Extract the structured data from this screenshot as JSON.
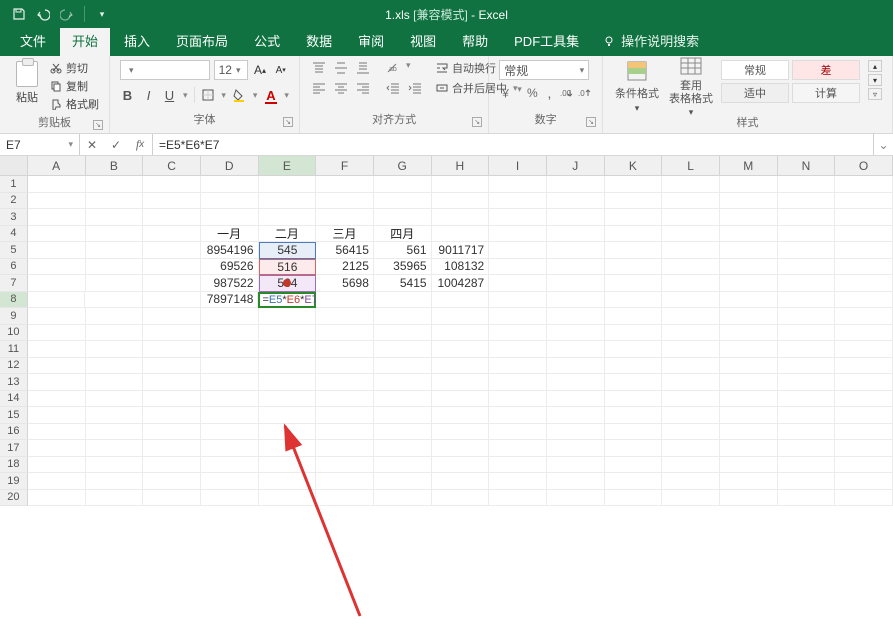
{
  "titlebar": {
    "filename": "1.xls",
    "compat": "[兼容模式]",
    "app": "Excel"
  },
  "tabs": {
    "file": "文件",
    "home": "开始",
    "insert": "插入",
    "layout": "页面布局",
    "formulas": "公式",
    "data": "数据",
    "review": "审阅",
    "view": "视图",
    "help": "帮助",
    "pdf": "PDF工具集",
    "tellme": "操作说明搜索"
  },
  "ribbon": {
    "clipboard": {
      "label": "剪贴板",
      "paste": "粘贴",
      "cut": "剪切",
      "copy": "复制",
      "brush": "格式刷"
    },
    "font": {
      "label": "字体",
      "size": "12"
    },
    "alignment": {
      "label": "对齐方式",
      "wrap": "自动换行",
      "merge": "合并后居中"
    },
    "number": {
      "label": "数字",
      "format": "常规"
    },
    "styles": {
      "label": "样式",
      "condfmt": "条件格式",
      "tablefmt": "套用\n表格格式",
      "normal": "常规",
      "bad": "差",
      "neutral": "适中",
      "calc": "计算"
    }
  },
  "fx": {
    "namebox": "E7",
    "formula": "=E5*E6*E7"
  },
  "grid": {
    "columns": [
      "A",
      "B",
      "C",
      "D",
      "E",
      "F",
      "G",
      "H",
      "I",
      "J",
      "K",
      "L",
      "M",
      "N",
      "O"
    ],
    "rows": 20,
    "headers_row": 4,
    "headers": {
      "D": "一月",
      "E": "二月",
      "F": "三月",
      "G": "四月"
    },
    "data": {
      "5": {
        "D": "8954196",
        "E": "545",
        "F": "56415",
        "G": "561",
        "H": "9011717"
      },
      "6": {
        "D": "69526",
        "E": "516",
        "F": "2125",
        "G": "35965",
        "H": "108132"
      },
      "7": {
        "D": "987522",
        "E": "564",
        "F": "5698",
        "G": "5415",
        "H": "1004287"
      },
      "8": {
        "D": "7897148"
      }
    },
    "editing_cell": {
      "row": 8,
      "col": "E",
      "tokens": [
        "=",
        "E5",
        "*",
        "E6",
        "*",
        "E7"
      ]
    },
    "selected_col": "E",
    "selected_row": 8
  },
  "chart_data": {
    "type": "table",
    "title": "",
    "columns": [
      "一月",
      "二月",
      "三月",
      "四月",
      ""
    ],
    "rows": [
      [
        8954196,
        545,
        56415,
        561,
        9011717
      ],
      [
        69526,
        516,
        2125,
        35965,
        108132
      ],
      [
        987522,
        564,
        5698,
        5415,
        1004287
      ],
      [
        7897148,
        null,
        null,
        null,
        null
      ]
    ]
  }
}
